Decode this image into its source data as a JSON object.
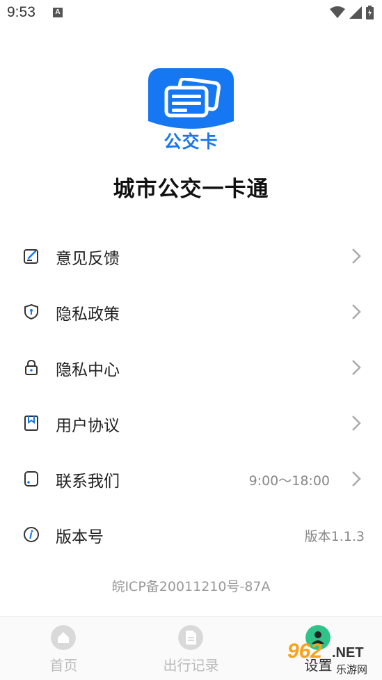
{
  "status_bar": {
    "time": "9:53",
    "notification_letter": "A"
  },
  "app": {
    "logo_text": "公交卡",
    "title": "城市公交一卡通"
  },
  "menu": [
    {
      "label": "意见反馈",
      "value": "",
      "icon": "feedback-icon"
    },
    {
      "label": "隐私政策",
      "value": "",
      "icon": "shield-icon"
    },
    {
      "label": "隐私中心",
      "value": "",
      "icon": "lock-icon"
    },
    {
      "label": "用户协议",
      "value": "",
      "icon": "bookmark-icon"
    },
    {
      "label": "联系我们",
      "value": "9:00～18:00",
      "icon": "phone-icon"
    },
    {
      "label": "版本号",
      "value": "版本1.1.3",
      "icon": "info-icon"
    }
  ],
  "icp": "皖ICP备20011210号-87A",
  "tabs": [
    {
      "label": "首页",
      "active": false,
      "icon": "home-icon"
    },
    {
      "label": "出行记录",
      "active": false,
      "icon": "document-icon"
    },
    {
      "label": "设置",
      "active": true,
      "icon": "user-icon"
    }
  ],
  "watermark": {
    "number": "962",
    "suffix": ".NET",
    "caption": "乐游网"
  },
  "colors": {
    "brand_blue": "#1677f2",
    "active_tab_green": "#2fc38a",
    "muted_text": "#999999"
  }
}
